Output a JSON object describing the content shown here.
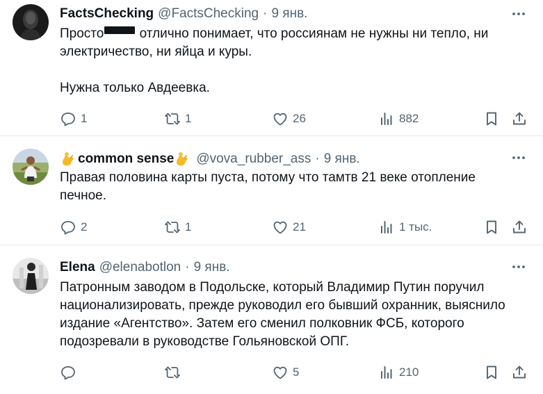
{
  "tweets": [
    {
      "display_name": "FactsChecking",
      "handle": "@FactsChecking",
      "date": "9 янв.",
      "text_lines": [
        {
          "before": "Просто",
          "after": "отлично понимает, что россиянам не нужны ни тепло, ни"
        },
        "электричество, ни яйца и куры.",
        "Нужна только Авдеевка."
      ],
      "replies": "1",
      "retweets": "1",
      "likes": "26",
      "views": "882"
    },
    {
      "display_name": "common sense",
      "handle": "@vova_rubber_ass",
      "date": "9 янв.",
      "text_lines": [
        "Правая половина карты пуста, потому что тамтв 21 веке отопление",
        "печное."
      ],
      "replies": "2",
      "retweets": "1",
      "likes": "21",
      "views": "1 тыс."
    },
    {
      "display_name": "Elena",
      "handle": "@elenabotlon",
      "date": "9 янв.",
      "text_lines": [
        "Патронным заводом в Подольске, который Владимир Путин поручил",
        "национализировать, прежде руководил его бывший охранник, выяснило",
        "издание «Агентство». Затем его сменил полковник ФСБ, которого",
        "подозревали в руководстве Гольяновской ОПГ."
      ],
      "replies": "",
      "retweets": "",
      "likes": "5",
      "views": "210"
    }
  ],
  "separator": "·",
  "icons": [
    "more-icon",
    "reply-icon",
    "retweet-icon",
    "like-icon",
    "views-icon",
    "bookmark-icon",
    "share-icon",
    "ok-hand-emoji"
  ],
  "colors": {
    "text_primary": "#0f1419",
    "text_secondary": "#536471",
    "divider": "#e5e9ec"
  }
}
